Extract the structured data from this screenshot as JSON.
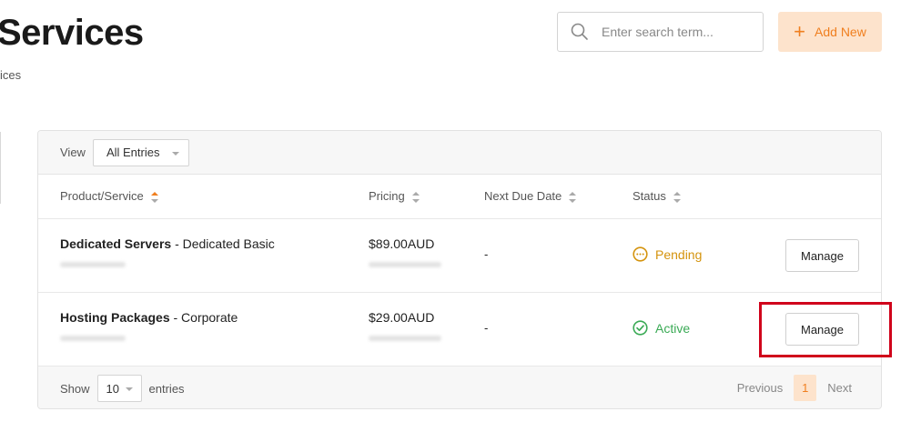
{
  "header": {
    "title": "Services",
    "breadcrumb": "ices",
    "search_placeholder": "Enter search term...",
    "add_new_label": "Add New",
    "accent_color": "#f07f1f"
  },
  "toolbar": {
    "view_label": "View",
    "view_value": "All Entries"
  },
  "table": {
    "columns": [
      "Product/Service",
      "Pricing",
      "Next Due Date",
      "Status"
    ],
    "rows": [
      {
        "product_group": "Dedicated Servers",
        "product_name": " - Dedicated Basic",
        "price": "$89.00AUD",
        "next_due": "-",
        "status": "Pending",
        "status_color": "#d4930d",
        "status_icon": "pending-clock-icon",
        "action": "Manage"
      },
      {
        "product_group": "Hosting Packages",
        "product_name": " - Corporate",
        "price": "$29.00AUD",
        "next_due": "-",
        "status": "Active",
        "status_color": "#3aaa55",
        "status_icon": "check-circle-icon",
        "action": "Manage"
      }
    ]
  },
  "footer": {
    "show_label": "Show",
    "show_value": "10",
    "entries_label": "entries",
    "previous_label": "Previous",
    "page": "1",
    "next_label": "Next"
  }
}
